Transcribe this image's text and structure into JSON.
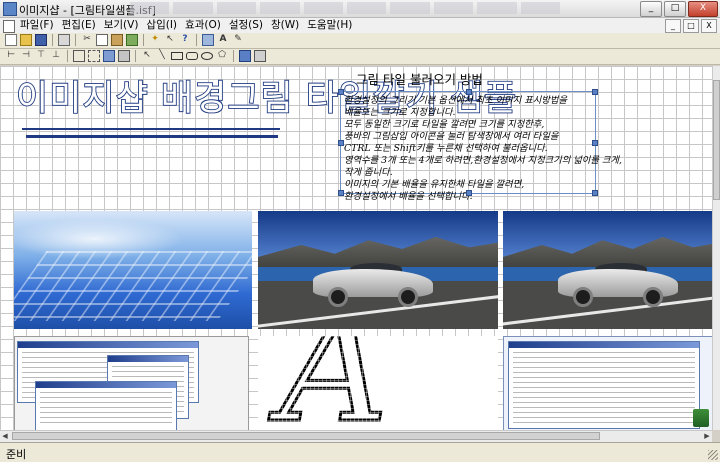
{
  "window": {
    "title": "이미지샵 - [그림타일샘플.isf]",
    "buttons": {
      "minimize": "_",
      "maximize": "□",
      "close": "X"
    }
  },
  "menu": {
    "items": [
      "파일(F)",
      "편집(E)",
      "보기(V)",
      "삽입(I)",
      "효과(O)",
      "설정(S)",
      "창(W)",
      "도움말(H)"
    ],
    "window_controls": [
      "_",
      "□",
      "X"
    ]
  },
  "toolbar1": {
    "icons": [
      "new-document-icon",
      "open-folder-icon",
      "save-icon",
      "print-icon",
      "cut-icon",
      "copy-icon",
      "paste-icon",
      "image-icon",
      "effect-icon",
      "pointer-help-icon",
      "question-help-icon",
      "window-icon",
      "text-icon",
      "pen-icon"
    ]
  },
  "toolbar2": {
    "icons": [
      "align-left-icon",
      "align-right-icon",
      "align-top-icon",
      "align-bottom-icon",
      "group-icon",
      "ungroup-icon",
      "bring-front-icon",
      "send-back-icon",
      "select-arrow-icon",
      "line-tool-icon",
      "rectangle-tool-icon",
      "rounded-rect-tool-icon",
      "ellipse-tool-icon",
      "polygon-tool-icon",
      "image-tool-icon",
      "camera-tool-icon"
    ]
  },
  "document": {
    "wordart": "이미지샵 배경그림 타일깔기 샘플",
    "section_title": "그림 타일 불러오기 방법",
    "instructions": [
      "환경설정의 그리기 기본 옵션에서 최초 이미지 표시방법을",
      "배율또는 크기로 지정합니다.",
      "모두 동일한 크기로 타일을 깔려면 크기를 지정한후,",
      "풍바의 그림삽입 아이콘을 눌러 탐색창에서 여러 타일을",
      "CTRL 또는 Shift키를 누른채 선택하여 불러옵니다.",
      "영역수를 3개 또는 4개로 하려면,환경설정에서 지정크기의 넓이를 크게,",
      "작게 줍니다.",
      "이미지의 기본 배율을 유지한채 타일을 깔려면,",
      "환경설정에서 배율을 선택합니다."
    ],
    "tiles": [
      {
        "name": "keyboard-image",
        "kind": "photo"
      },
      {
        "name": "car-image",
        "kind": "photo"
      },
      {
        "name": "car-image",
        "kind": "photo"
      },
      {
        "name": "screenshot-image",
        "kind": "screenshot"
      },
      {
        "name": "letter-image",
        "text": "A"
      },
      {
        "name": "screenshot-image",
        "kind": "screenshot"
      }
    ]
  },
  "status": {
    "text": "준비"
  },
  "colors": {
    "wordart_stroke": "#1f3a82",
    "selection": "#5a7fc4"
  }
}
